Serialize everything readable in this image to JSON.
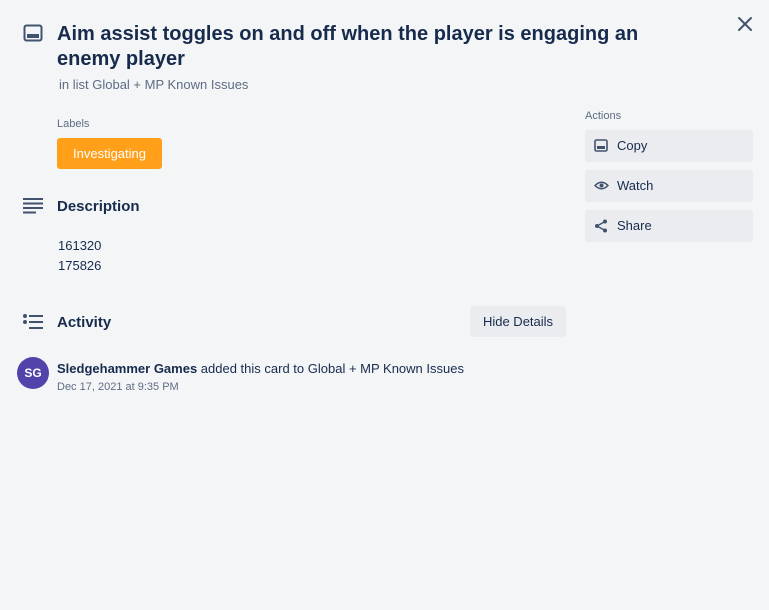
{
  "card": {
    "title": "Aim assist toggles on and off when the player is engaging an enemy player",
    "in_list": "in list Global + MP Known Issues"
  },
  "labels": {
    "heading": "Labels",
    "items": [
      {
        "text": "Investigating",
        "color": "#ff9f1a"
      }
    ]
  },
  "description": {
    "heading": "Description",
    "lines": [
      "161320",
      "175826"
    ]
  },
  "activity": {
    "heading": "Activity",
    "hide_details_label": "Hide Details",
    "entries": [
      {
        "avatar_initials": "SG",
        "author": "Sledgehammer Games",
        "action": " added this card to Global + MP Known Issues",
        "timestamp": "Dec 17, 2021 at 9:35 PM"
      }
    ]
  },
  "actions": {
    "heading": "Actions",
    "buttons": [
      {
        "label": "Copy",
        "icon": "card-icon"
      },
      {
        "label": "Watch",
        "icon": "eye-icon"
      },
      {
        "label": "Share",
        "icon": "share-icon"
      }
    ]
  },
  "colors": {
    "background": "#f4f5f7",
    "text": "#172b4d",
    "muted": "#5e6c84",
    "button_bg": "#ebecf0",
    "avatar": "#5243aa"
  }
}
